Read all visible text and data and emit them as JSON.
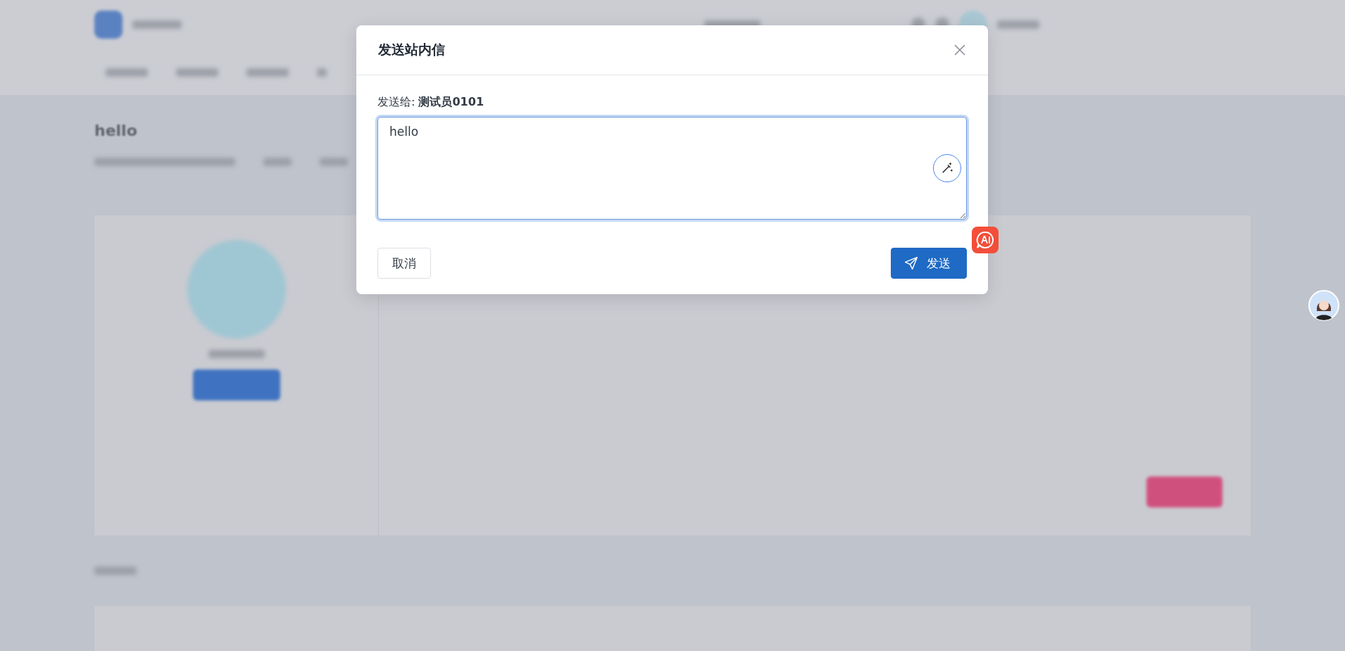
{
  "page": {
    "title": "hello"
  },
  "dialog": {
    "title": "发送站内信",
    "recipient": "发送给: **测试员0101**",
    "message": "hello",
    "buttons": [
      {
        "kind": "cancel",
        "label": "取消"
      },
      {
        "kind": "send",
        "label": "发送"
      }
    ]
  }
}
